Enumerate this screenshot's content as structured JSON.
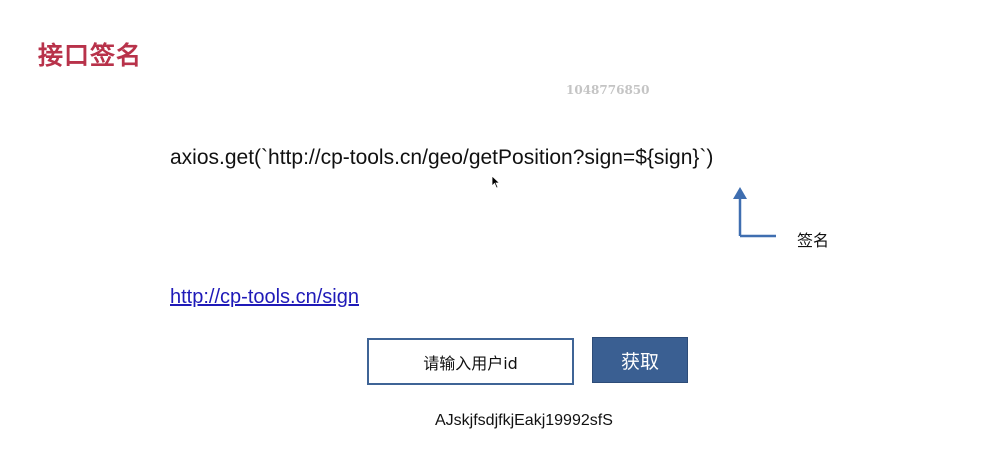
{
  "slide": {
    "title": "接口签名",
    "watermark": "1048776850",
    "code_line": "axios.get(`http://cp-tools.cn/geo/getPosition?sign=${sign}`)",
    "arrow_label": "签名",
    "link_text": "http://cp-tools.cn/sign",
    "input_placeholder": "请输入用户id",
    "button_label": "获取",
    "result_text": "AJskjfsdjfkjEakj19992sfS"
  },
  "colors": {
    "title": "#b8324a",
    "accent": "#3a5f92",
    "link": "#1f1ab8"
  },
  "icons": {
    "cursor": "mouse-pointer-icon",
    "arrow": "up-arrow-icon"
  }
}
